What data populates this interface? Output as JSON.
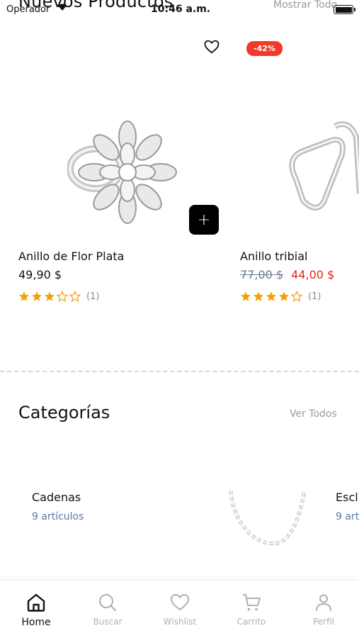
{
  "status_bar": {
    "carrier": "Operador",
    "time": "10:46 a.m."
  },
  "new_products": {
    "title": "Nuevos Productos",
    "show_all": "Mostrar Todo",
    "items": [
      {
        "name": "Anillo de Flor Plata",
        "price": "49,90 $",
        "rating": 3,
        "rating_count": "(1)",
        "add_label": "+"
      },
      {
        "name": "Anillo tribial",
        "old_price": "77,00 $",
        "price": "44,00 $",
        "discount": "-42%",
        "rating": 4,
        "rating_count": "(1)"
      }
    ]
  },
  "categories": {
    "title": "Categorías",
    "show_all": "Ver Todos",
    "items": [
      {
        "name": "Cadenas",
        "count": "9 artículos"
      },
      {
        "name": "Escl",
        "count": "9 art"
      }
    ]
  },
  "bottom_nav": {
    "items": [
      {
        "label": "Home",
        "icon": "home-icon",
        "active": true
      },
      {
        "label": "Buscar",
        "icon": "search-icon",
        "active": false
      },
      {
        "label": "Wishlist",
        "icon": "heart-icon",
        "active": false
      },
      {
        "label": "Carrito",
        "icon": "cart-icon",
        "active": false
      },
      {
        "label": "Perfil",
        "icon": "user-icon",
        "active": false
      }
    ]
  },
  "colors": {
    "accent_red": "#e3261b",
    "star": "#f5a00b",
    "category_count": "#5b78a6"
  }
}
